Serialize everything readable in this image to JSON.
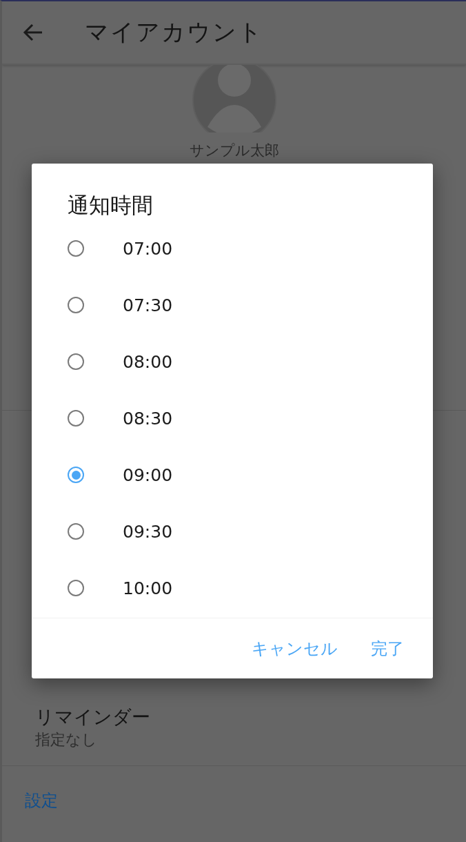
{
  "app_bar": {
    "title": "マイアカウント"
  },
  "profile": {
    "name": "サンプル太郎"
  },
  "reminder": {
    "label": "リマインダー",
    "value": "指定なし"
  },
  "settings_link": "設定",
  "dialog": {
    "title": "通知時間",
    "options": [
      {
        "label": "07:00",
        "selected": false
      },
      {
        "label": "07:30",
        "selected": false
      },
      {
        "label": "08:00",
        "selected": false
      },
      {
        "label": "08:30",
        "selected": false
      },
      {
        "label": "09:00",
        "selected": true
      },
      {
        "label": "09:30",
        "selected": false
      },
      {
        "label": "10:00",
        "selected": false
      }
    ],
    "buttons": [
      "キャンセル",
      "完了"
    ]
  }
}
